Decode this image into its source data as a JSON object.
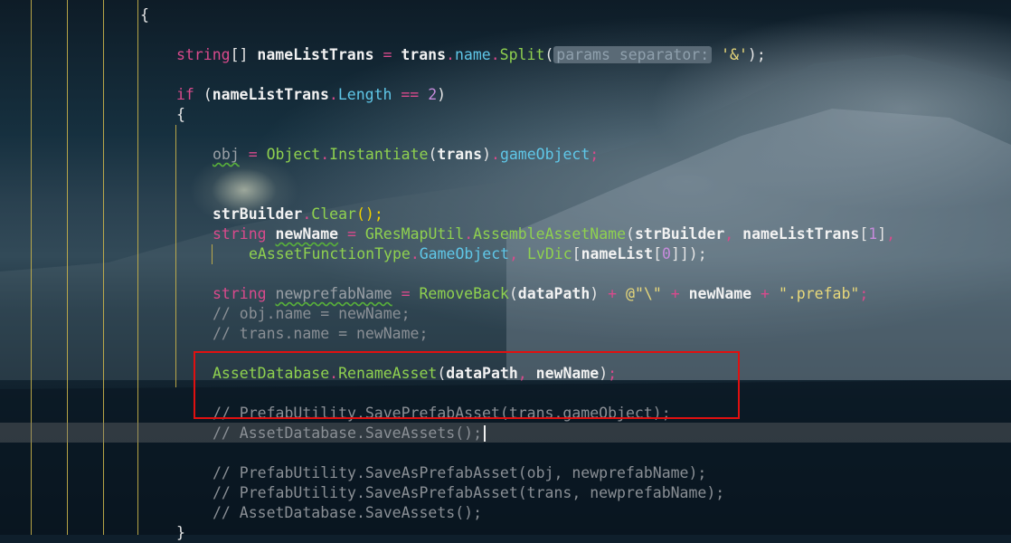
{
  "editor": {
    "lines": {
      "l0": "{",
      "l1_type": "string",
      "l1_br": "[] ",
      "l1_var": "nameListTrans",
      "l1_eq": " = ",
      "l1_obj": "trans",
      "l1_mem": "name",
      "l1_fn": "Split",
      "l1_hint": "params separator:",
      "l1_str": "'&'",
      "l1_end": ");",
      "l2_kw": "if",
      "l2_a": " (",
      "l2_var": "nameListTrans",
      "l2_mem": "Length",
      "l2_op": " == ",
      "l2_num": "2",
      "l2_b": ")",
      "l3": "{",
      "l4_var": "obj",
      "l4_eq": " = ",
      "l4_cls": "Object",
      "l4_fn": "Instantiate",
      "l4_arg": "trans",
      "l4_mem": "gameObject",
      "l5_var": "strBuilder",
      "l5_fn": "Clear",
      "l5_end": "();",
      "l6_type": "string",
      "l6_var": "newName",
      "l6_eq": " = ",
      "l6_cls": "GResMapUtil",
      "l6_fn": "AssembleAssetName",
      "l6_a1": "strBuilder",
      "l6_a2": "nameListTrans",
      "l6_num": "1",
      "l7_cls": "eAssetFunctionType",
      "l7_mem": "GameObject",
      "l7_fn": "LvDic",
      "l7_a": "nameList",
      "l7_num": "0",
      "l8_type": "string",
      "l8_var": "newprefabName",
      "l8_eq": " = ",
      "l8_fn": "RemoveBack",
      "l8_a": "dataPath",
      "l8_s1": "@\"\\\"",
      "l8_b": "newName",
      "l8_s2": "\".prefab\"",
      "l9": "// obj.name = newName;",
      "l10": "// trans.name = newName;",
      "l11_cls": "AssetDatabase",
      "l11_fn": "RenameAsset",
      "l11_a": "dataPath",
      "l11_b": "newName",
      "l12": "// PrefabUtility.SavePrefabAsset(trans.gameObject);",
      "l13": "// AssetDatabase.SaveAssets();",
      "l14": "// PrefabUtility.SaveAsPrefabAsset(obj, newprefabName);",
      "l15": "// PrefabUtility.SaveAsPrefabAsset(trans, newprefabName);",
      "l16": "// AssetDatabase.SaveAssets();",
      "l17": "}"
    }
  },
  "colors": {
    "keyword": "#d94a8c",
    "type": "#8fd14f",
    "member": "#5fc7e8",
    "number": "#c78bdc",
    "string": "#e8d87a",
    "comment": "#8a8f95",
    "annotation_box": "#e01010"
  }
}
